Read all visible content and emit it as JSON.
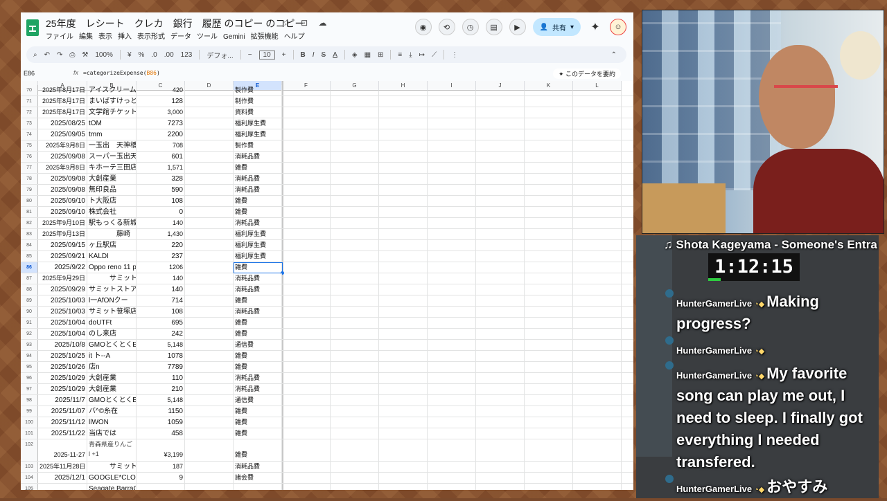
{
  "document": {
    "title": "25年度　レシート　クレカ　銀行　履歴 のコピー のコピー",
    "menu": [
      "ファイル",
      "編集",
      "表示",
      "挿入",
      "表示形式",
      "データ",
      "ツール",
      "Gemini",
      "拡張機能",
      "ヘルプ"
    ],
    "share_label": "共有",
    "title_icons": "☆ ⊡ ☁"
  },
  "toolbar": {
    "zoom": "100%",
    "currency": "¥",
    "percent": "%",
    "dec_less": ".0",
    "dec_more": ".00",
    "num_format": "123",
    "font": "デフォ...",
    "font_size": "10",
    "bold": "B",
    "italic": "I",
    "strike": "S",
    "text_color": "A"
  },
  "formula": {
    "cell_ref": "E86",
    "fx": "fx",
    "formula_prefix": "=categorizeExpense(",
    "formula_arg": "B86",
    "formula_suffix": ")",
    "summarize_label": "このデータを要約"
  },
  "columns": [
    "A",
    "B",
    "C",
    "D",
    "E",
    "F",
    "G",
    "H",
    "I",
    "J",
    "K",
    "L"
  ],
  "rows": [
    {
      "n": "70",
      "a": "2025年8月17日",
      "b": "アイスクリーム",
      "c": "420",
      "e": "製作費",
      "small_a": true,
      "small_c": true
    },
    {
      "n": "71",
      "a": "2025年8月17日",
      "b": "まいばすけっと",
      "c": "128",
      "e": "制作費",
      "small_a": true
    },
    {
      "n": "72",
      "a": "2025年8月17日",
      "b": "文学館チケット",
      "c": "3,000",
      "e": "資料費",
      "small_a": true,
      "small_c": true
    },
    {
      "n": "73",
      "a": "2025/08/25",
      "b": "tOM",
      "c": "7273",
      "e": "福利厚生費"
    },
    {
      "n": "74",
      "a": "2025/09/05",
      "b": "tmm",
      "c": "2200",
      "e": "福利厚生費"
    },
    {
      "n": "75",
      "a": "2025年9月8日",
      "b": "一玉出　天神橋",
      "c": "708",
      "e": "製作費",
      "small_a": true,
      "small_c": true
    },
    {
      "n": "76",
      "a": "2025/09/08",
      "b": "スーパー玉出天",
      "c": "601",
      "e": "消耗品費"
    },
    {
      "n": "77",
      "a": "2025年9月8日",
      "b": "キホーテ三田店",
      "c": "1,571",
      "e": "雑費",
      "small_a": true,
      "small_c": true
    },
    {
      "n": "78",
      "a": "2025/09/08",
      "b": "大創産業",
      "c": "328",
      "e": "消耗品費"
    },
    {
      "n": "79",
      "a": "2025/09/08",
      "b": "無印良品",
      "c": "590",
      "e": "消耗品費"
    },
    {
      "n": "80",
      "a": "2025/09/10",
      "b": "ト大阪店",
      "c": "108",
      "e": "雑費"
    },
    {
      "n": "81",
      "a": "2025/09/10",
      "b": "株式会社",
      "c": "0",
      "e": "雑費"
    },
    {
      "n": "82",
      "a": "2025年9月10日",
      "b": "駅もっくる新城",
      "c": "140",
      "e": "消耗品費",
      "small_a": true,
      "small_c": true
    },
    {
      "n": "83",
      "a": "2025年9月13日",
      "b": "　　　　藤崎",
      "c": "1,430",
      "e": "福利厚生費",
      "small_a": true,
      "small_c": true
    },
    {
      "n": "84",
      "a": "2025/09/15",
      "b": "ヶ丘駅店",
      "c": "220",
      "e": "福利厚生費"
    },
    {
      "n": "85",
      "a": "2025/09/21",
      "b": "KALDI",
      "c": "237",
      "e": "福利厚生費"
    },
    {
      "n": "86",
      "a": "2025/9/22",
      "b": "Oppo reno 11 p",
      "c": "1206",
      "e": "雑費",
      "selected": true,
      "small_c": true
    },
    {
      "n": "87",
      "a": "2025年9月29日",
      "b": "　　　サミット",
      "c": "140",
      "e": "消耗品費",
      "small_a": true,
      "small_c": true
    },
    {
      "n": "88",
      "a": "2025/09/29",
      "b": "サミットストア",
      "c": "140",
      "e": "消耗品費"
    },
    {
      "n": "89",
      "a": "2025/10/03",
      "b": "l一AfONクー",
      "c": "714",
      "e": "雑費"
    },
    {
      "n": "90",
      "a": "2025/10/03",
      "b": "サミット笹塚店",
      "c": "108",
      "e": "消耗品費"
    },
    {
      "n": "91",
      "a": "2025/10/04",
      "b": "doUTFt",
      "c": "695",
      "e": "雑費"
    },
    {
      "n": "92",
      "a": "2025/10/04",
      "b": "のし来店",
      "c": "242",
      "e": "雑費"
    },
    {
      "n": "93",
      "a": "2025/10/8",
      "b": "GMOとくとくE",
      "c": "5,148",
      "e": "通信費",
      "small_c": true
    },
    {
      "n": "94",
      "a": "2025/10/25",
      "b": "it ト--A",
      "c": "1078",
      "e": "雑費"
    },
    {
      "n": "95",
      "a": "2025/10/26",
      "b": "店n",
      "c": "7789",
      "e": "雑費"
    },
    {
      "n": "96",
      "a": "2025/10/29",
      "b": "大創産業",
      "c": "110",
      "e": "消耗品費"
    },
    {
      "n": "97",
      "a": "2025/10/29",
      "b": "大創産業",
      "c": "210",
      "e": "消耗品費"
    },
    {
      "n": "98",
      "a": "2025/11/7",
      "b": "GMOとくとくE",
      "c": "5,148",
      "e": "通信費",
      "small_c": true
    },
    {
      "n": "99",
      "a": "2025/11/07",
      "b": "バ^©糸在",
      "c": "1150",
      "e": "雑費"
    },
    {
      "n": "100",
      "a": "2025/11/12",
      "b": "llWON",
      "c": "1059",
      "e": "雑費"
    },
    {
      "n": "101",
      "a": "2025/11/22",
      "b": "当店では",
      "c": "458",
      "e": "雑費"
    },
    {
      "n": "102",
      "a": "2025-11-27",
      "b": "青森県産りんご l +1",
      "c": "¥3,199",
      "e": "雑費",
      "tall": true,
      "small_a": true,
      "small_c": true
    },
    {
      "n": "103",
      "a": "2025年11月28日",
      "b": "　　　サミット",
      "c": "187",
      "e": "消耗品費",
      "small_a": true,
      "small_c": true
    },
    {
      "n": "104",
      "a": "2025/12/1",
      "b": "GOOGLE*CLO",
      "c": "9",
      "e": "諸会費"
    },
    {
      "n": "105",
      "a": "",
      "b": "Seagate BarraCu",
      "c": "",
      "e": "",
      "small_a": true
    }
  ],
  "stream": {
    "now_playing": "♫ Shota Kageyama - Someone's Entra",
    "timer": "1:12:15",
    "messages": [
      {
        "user": "HunterGamerLive",
        "text": "Making progress?"
      },
      {
        "user": "HunterGamerLive",
        "text": ""
      },
      {
        "user": "HunterGamerLive",
        "text": "My favorite song can play me out, I need to sleep. I finally got everything I needed transfered."
      },
      {
        "user": "HunterGamerLive",
        "text": "おやすみ"
      }
    ]
  }
}
